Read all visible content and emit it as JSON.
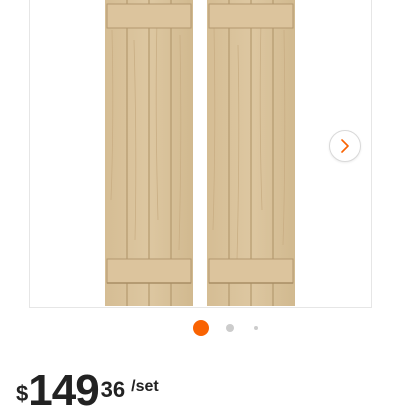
{
  "carousel": {
    "next_icon": "chevron-right-icon",
    "dots": [
      {
        "active": true,
        "color": "#f96302"
      },
      {
        "active": false,
        "color": "#cccccc"
      },
      {
        "active": false,
        "color": "#cccccc"
      }
    ]
  },
  "price": {
    "currency": "$",
    "dollars": "149",
    "cents": "36",
    "unit": "/set"
  },
  "colors": {
    "accent": "#f96302",
    "wood": "#d9c29b"
  }
}
